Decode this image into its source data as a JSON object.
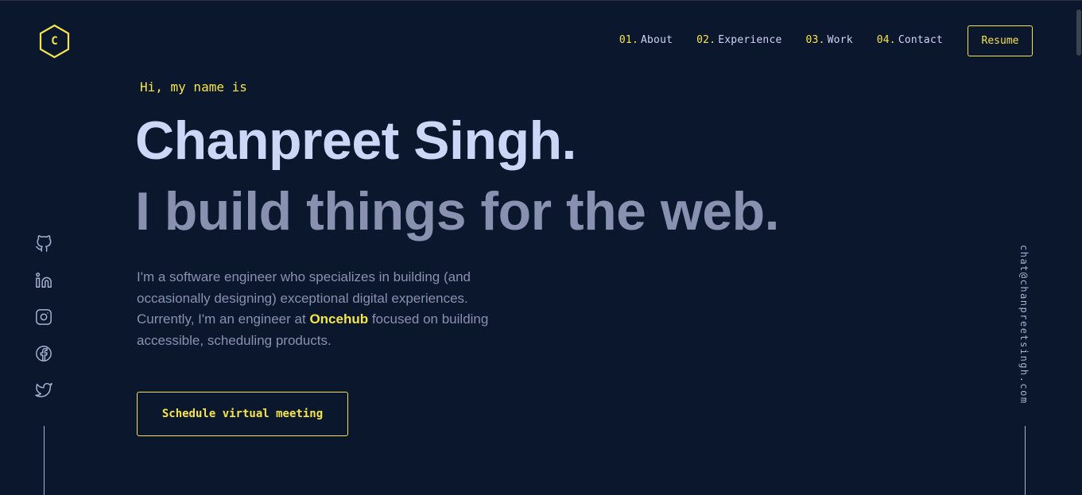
{
  "brand": {
    "logo_letter": "C",
    "accent": "#f5e44b",
    "background": "#0b172d"
  },
  "nav": {
    "items": [
      {
        "num": "01.",
        "label": "About"
      },
      {
        "num": "02.",
        "label": "Experience"
      },
      {
        "num": "03.",
        "label": "Work"
      },
      {
        "num": "04.",
        "label": "Contact"
      }
    ],
    "resume_label": "Resume"
  },
  "hero": {
    "greeting": "Hi, my name is",
    "name": "Chanpreet Singh.",
    "tagline": "I build things for the web.",
    "bio_before": "I'm a software engineer who specializes in building (and occasionally designing) exceptional digital experiences. Currently, I'm an engineer at ",
    "bio_link": "Oncehub",
    "bio_after": " focused on building accessible, scheduling products.",
    "cta_label": "Schedule virtual meeting"
  },
  "socials": [
    "github-icon",
    "linkedin-icon",
    "instagram-icon",
    "facebook-icon",
    "twitter-icon"
  ],
  "email": "chat@chanpreetsingh.com"
}
